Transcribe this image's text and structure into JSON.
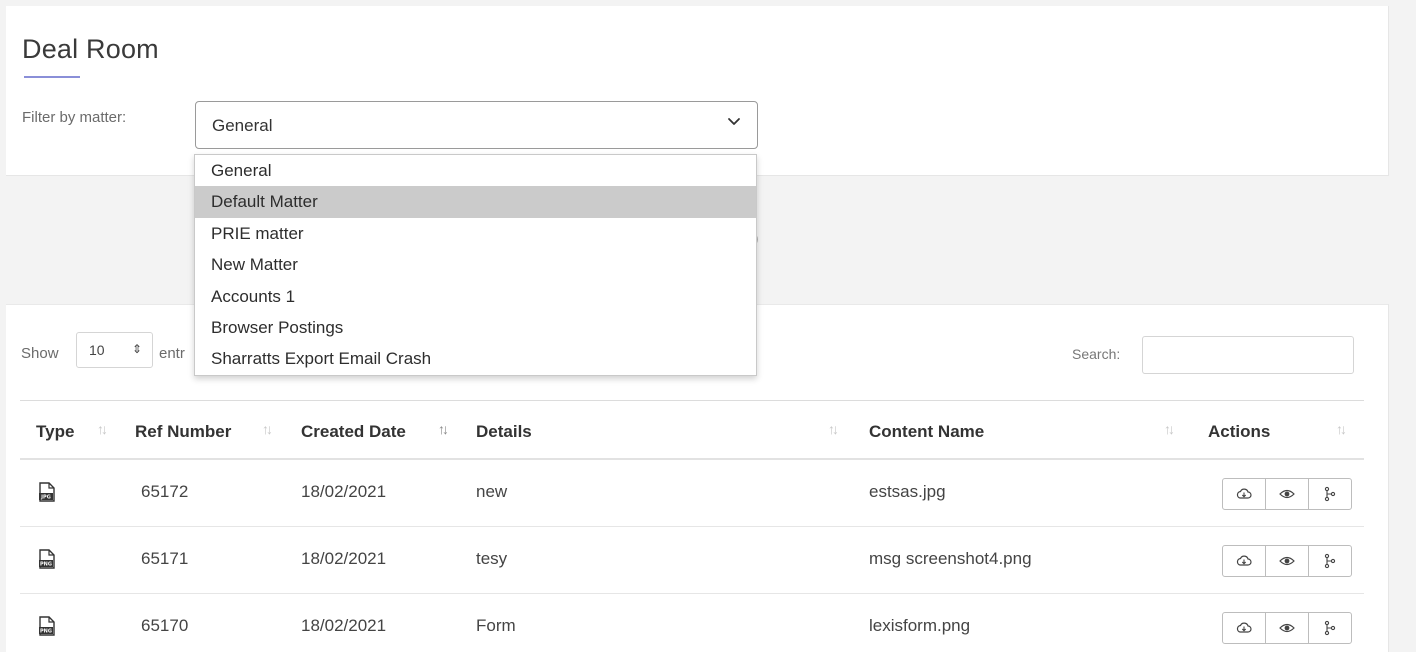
{
  "page": {
    "title": "Deal Room"
  },
  "filter": {
    "label": "Filter by matter:",
    "selected": "General",
    "options": [
      "General",
      "Default Matter",
      "PRIE matter",
      "New Matter",
      "Accounts 1",
      "Browser Postings",
      "Sharratts Export Email Crash"
    ],
    "highlighted_option": "Default Matter"
  },
  "middle": {
    "fragment": ")"
  },
  "table_controls": {
    "show_label": "Show",
    "page_length": "10",
    "entries_fragment": "entr",
    "search_label": "Search:",
    "search_value": ""
  },
  "table": {
    "columns": [
      "Type",
      "Ref Number",
      "Created Date",
      "Details",
      "Content Name",
      "Actions"
    ],
    "sort_glyph": "↑↓",
    "rows": [
      {
        "type_icon": "jpg-file-icon",
        "ref": "65172",
        "date": "18/02/2021",
        "details": "new",
        "content": "estsas.jpg"
      },
      {
        "type_icon": "png-file-icon",
        "ref": "65171",
        "date": "18/02/2021",
        "details": "tesy",
        "content": "msg screenshot4.png"
      },
      {
        "type_icon": "png-file-icon",
        "ref": "65170",
        "date": "18/02/2021",
        "details": "Form",
        "content": "lexisform.png"
      }
    ],
    "action_icons": [
      "cloud-download-icon",
      "eye-icon",
      "share-icon"
    ]
  },
  "colors": {
    "accent_underline": "#8a8fd8",
    "highlight": "#cbcbcb",
    "background": "#f3f3f3"
  }
}
